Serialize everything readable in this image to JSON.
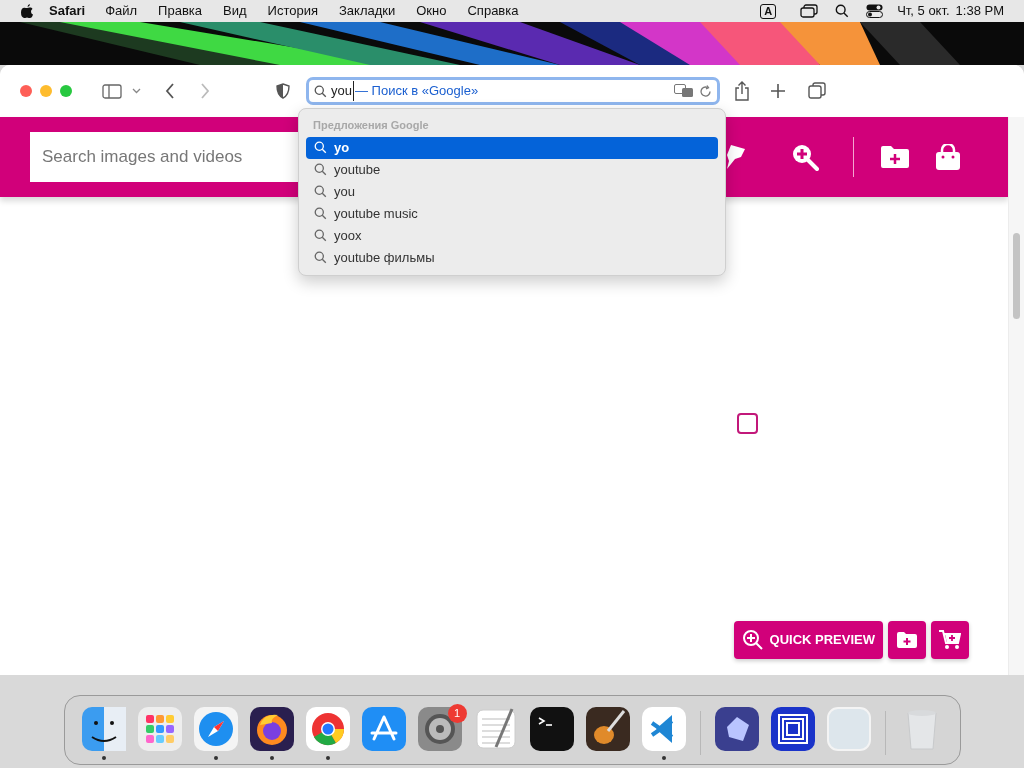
{
  "menu_bar": {
    "app": "Safari",
    "menus": [
      "Файл",
      "Правка",
      "Вид",
      "История",
      "Закладки",
      "Окно",
      "Справка"
    ],
    "input_source": "A",
    "date": "Чт, 5 окт.",
    "time": "1:38 PM"
  },
  "toolbar": {
    "address": {
      "value": "you",
      "hint": "— Поиск в «Google»"
    }
  },
  "suggestions": {
    "header": "Предложения Google",
    "items": [
      {
        "label": "yo",
        "selected": true
      },
      {
        "label": "youtube",
        "selected": false
      },
      {
        "label": "you",
        "selected": false
      },
      {
        "label": "youtube music",
        "selected": false
      },
      {
        "label": "yoox",
        "selected": false
      },
      {
        "label": "youtube фильмы",
        "selected": false
      }
    ]
  },
  "site_header": {
    "search": {
      "placeholder": "Search images and videos"
    }
  },
  "content": {
    "select_checkbox": {
      "checked": false
    },
    "quick_preview": "QUICK PREVIEW"
  },
  "dock": {
    "items": [
      {
        "kind": "finder",
        "running": true
      },
      {
        "kind": "launchpad",
        "running": false
      },
      {
        "kind": "safari",
        "running": true
      },
      {
        "kind": "firefox",
        "running": true
      },
      {
        "kind": "chrome",
        "running": true
      },
      {
        "kind": "appstore",
        "running": false
      },
      {
        "kind": "settings",
        "running": false,
        "badge": "1"
      },
      {
        "kind": "textedit",
        "running": false
      },
      {
        "kind": "terminal",
        "running": false
      },
      {
        "kind": "garageband",
        "running": false
      },
      {
        "kind": "vscode",
        "running": true
      },
      {
        "kind": "separator"
      },
      {
        "kind": "crystal",
        "running": false
      },
      {
        "kind": "squares",
        "running": false
      },
      {
        "kind": "blank",
        "running": false
      },
      {
        "kind": "separator"
      },
      {
        "kind": "trash",
        "running": false
      }
    ]
  }
}
